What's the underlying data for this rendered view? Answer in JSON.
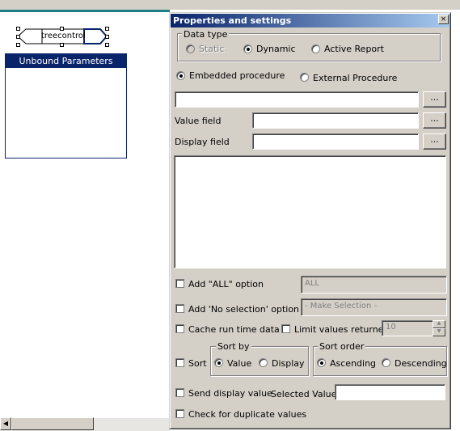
{
  "canvas": {
    "tree_control_label": "treecontrol",
    "unbound_panel_title": "Unbound Parameters"
  },
  "dialog": {
    "title": "Properties and settings",
    "close_glyph": "×",
    "data_type": {
      "legend": "Data type",
      "options": [
        {
          "label": "Static",
          "selected": false,
          "enabled": false
        },
        {
          "label": "Dynamic",
          "selected": true,
          "enabled": true
        },
        {
          "label": "Active Report",
          "selected": false,
          "enabled": true
        }
      ]
    },
    "procedure": {
      "embedded_label": "Embedded procedure",
      "embedded_selected": true,
      "external_label": "External Procedure",
      "external_selected": false
    },
    "browse_label": "...",
    "procedure_value": "",
    "value_field_label": "Value field",
    "value_field_value": "",
    "display_field_label": "Display field",
    "display_field_value": "",
    "sql_text": "",
    "add_all": {
      "label": "Add \"ALL\" option",
      "checked": false,
      "text": "ALL"
    },
    "add_no_selection": {
      "label": "Add 'No selection' option",
      "checked": false,
      "text": "- Make Selection -"
    },
    "cache_label": "Cache run time data",
    "cache_checked": false,
    "limit_label": "Limit values returned",
    "limit_checked": false,
    "limit_value": "10",
    "sort_label": "Sort",
    "sort_checked": false,
    "sort_by": {
      "legend": "Sort by",
      "value_label": "Value",
      "display_label": "Display",
      "selected": "Value"
    },
    "sort_order": {
      "legend": "Sort order",
      "asc_label": "Ascending",
      "desc_label": "Descending",
      "selected": "Ascending"
    },
    "send_display_label": "Send display value",
    "send_display_checked": false,
    "selected_value_label": "Selected Value",
    "selected_value": "",
    "duplicates_label": "Check for duplicate values",
    "duplicates_checked": false
  },
  "colors": {
    "dialog_face": "#d4d0c8",
    "title_gradient_start": "#0a246a",
    "title_gradient_end": "#a6caf0",
    "teal_accent": "#1e7f86"
  }
}
